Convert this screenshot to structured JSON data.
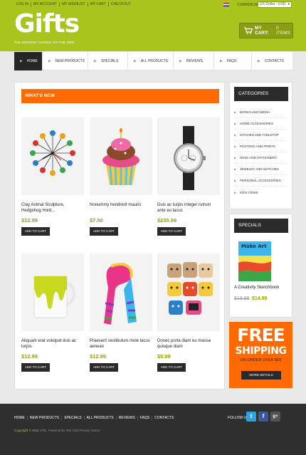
{
  "colors": {
    "accent_green": "#a9c41c",
    "accent_orange": "#ff6a00",
    "dark": "#2b2b2b",
    "price_green": "#8ea70e"
  },
  "topbar": {
    "links": [
      "Log In",
      "My Account",
      "My Wishlist",
      "My Cart",
      "Checkout"
    ],
    "currencies_label": "Currencies",
    "currency_value": "US Dollar - USD",
    "flag_icon": "uk-flag-icon"
  },
  "header": {
    "logo": "Gifts",
    "tagline": "The biggest choice on the web",
    "cart_label": "my cart:",
    "cart_count": "0 items",
    "cart_icon": "shopping-cart-icon"
  },
  "nav": {
    "items": [
      "Home",
      "New Products",
      "Specials",
      "All Products",
      "Reviews",
      "FAQs",
      "Contacts"
    ]
  },
  "main": {
    "heading": "What's New",
    "add_to_cart": "Add to cart",
    "products": [
      {
        "name": "Clay Animal Sculpture, Hedgehog Hord...",
        "price": "$12.99",
        "image": "ball-clock"
      },
      {
        "name": "Nonummy hendrerit mauris",
        "price": "$7.50",
        "image": "cupcake"
      },
      {
        "name": "Duis ac turpis integer rutrum ante eu lacus",
        "price": "$235.99",
        "image": "watch"
      },
      {
        "name": "Aliquam erat volutpat duis ac turpis",
        "price": "$12.99",
        "image": "mug"
      },
      {
        "name": "Praesent vestibulum mole lacus aenean",
        "price": "$12.99",
        "image": "scarf"
      },
      {
        "name": "Donec porta diam eu massa quisque diam",
        "price": "$5.99",
        "image": "animal-toys"
      }
    ]
  },
  "sidebar": {
    "categories_title": "Categories",
    "categories": [
      "Books and media",
      "Home accessories",
      "Kitchen and tabletop",
      "Posters and prints",
      "Desk and stationery",
      "Jewelry and watches",
      "Personal accessories",
      "Kids items"
    ],
    "specials_title": "Specials",
    "special": {
      "name": "A Creativity Sketchbook",
      "old_price": "$18.99",
      "new_price": "$14.99",
      "book_title": "Make Art"
    },
    "promo": {
      "big": "FREE",
      "shipping": "SHIPPING",
      "sub": "on order over $50",
      "button": "More details"
    }
  },
  "footer": {
    "links": [
      "Home",
      "New Products",
      "Specials",
      "All Products",
      "Reviews",
      "FAQs",
      "Contacts"
    ],
    "follow_label": "Follow us",
    "social": [
      "twitter-icon",
      "facebook-icon",
      "google-plus-icon"
    ],
    "copyright_year": "Copyright © 2011",
    "copyright_rest": "Gifts. Powered by Zen Cart Privacy Notice"
  }
}
